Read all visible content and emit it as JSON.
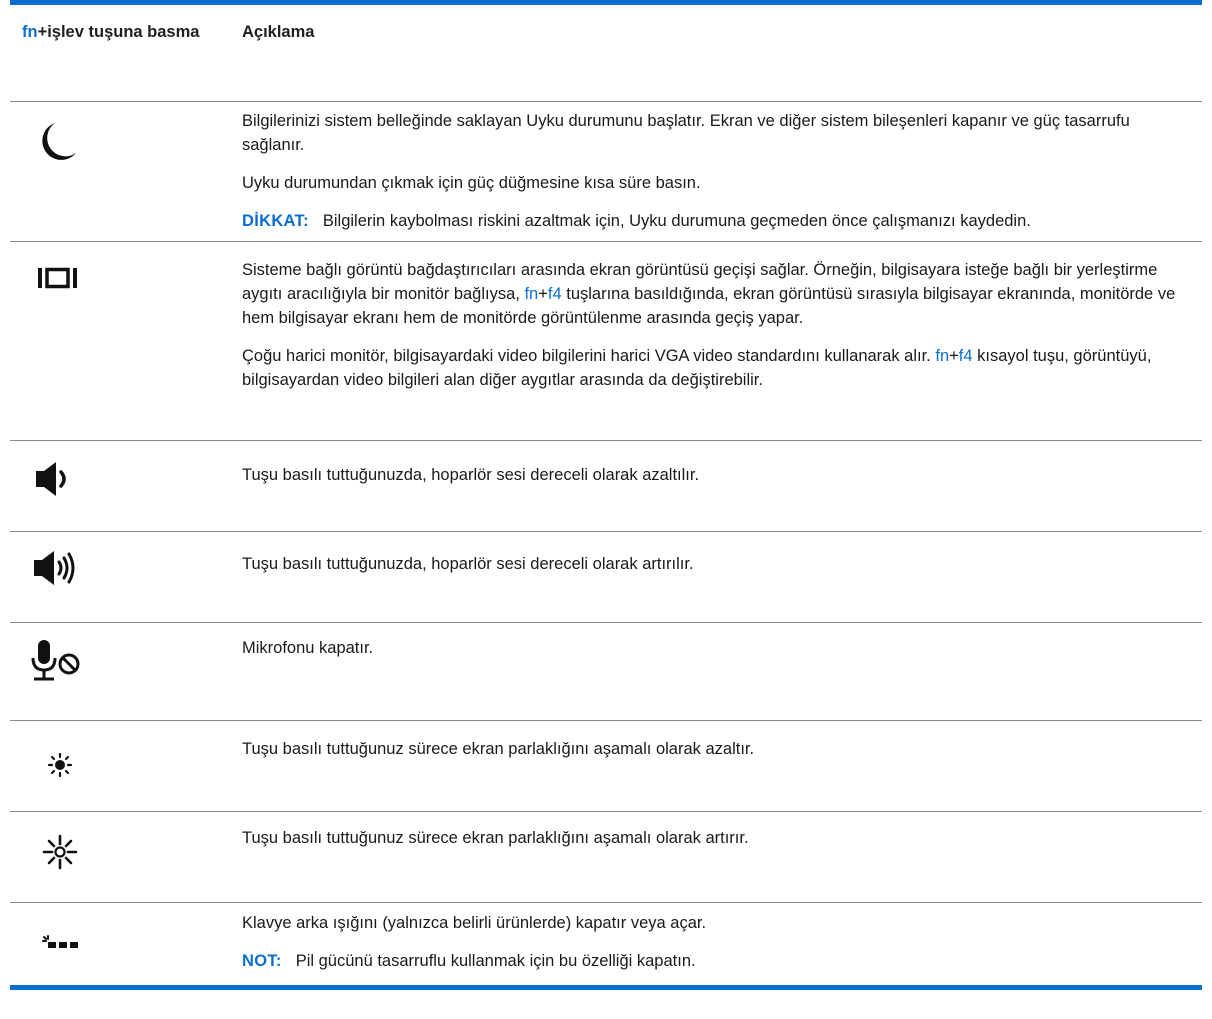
{
  "header": {
    "col1_fn": "fn",
    "col1_rest": "+işlev tuşuna basma",
    "col2": "Açıklama"
  },
  "rows": [
    {
      "icon": "moon-icon",
      "p1": "Bilgilerinizi sistem belleğinde saklayan Uyku durumunu başlatır. Ekran ve diğer sistem bileşenleri kapanır ve güç tasarrufu sağlanır.",
      "p2": "Uyku durumundan çıkmak için güç düğmesine kısa süre basın.",
      "note_label": "DİKKAT:",
      "note_text": "Bilgilerin kaybolması riskini azaltmak için, Uyku durumuna geçmeden önce çalışmanızı kaydedin."
    },
    {
      "icon": "display-switch-icon",
      "p1_a": "Sisteme bağlı görüntü bağdaştırıcıları arasında ekran görüntüsü geçişi sağlar. Örneğin, bilgisayara isteğe bağlı bir yerleştirme aygıtı aracılığıyla bir monitör bağlıysa,",
      "p1_fn": "fn",
      "p1_plus": "+",
      "p1_f4": "f4",
      "p1_b": "tuşlarına basıldığında, ekran görüntüsü sırasıyla bilgisayar ekranında, monitörde ve hem bilgisayar ekranı hem de monitörde görüntülenme arasında geçiş yapar.",
      "p2_a": "Çoğu harici monitör, bilgisayardaki video bilgilerini harici VGA video standardını kullanarak alır.",
      "p2_fn": "fn",
      "p2_plus": "+",
      "p2_f4": "f4",
      "p2_b": "kısayol tuşu, görüntüyü, bilgisayardan video bilgileri alan diğer aygıtlar arasında da değiştirebilir."
    },
    {
      "icon": "volume-down-icon",
      "p1": "Tuşu basılı tuttuğunuzda, hoparlör sesi dereceli olarak azaltılır."
    },
    {
      "icon": "volume-up-icon",
      "p1": "Tuşu basılı tuttuğunuzda, hoparlör sesi dereceli olarak artırılır."
    },
    {
      "icon": "mic-mute-icon",
      "p1": "Mikrofonu kapatır."
    },
    {
      "icon": "brightness-down-icon",
      "p1": "Tuşu basılı tuttuğunuz sürece ekran parlaklığını aşamalı olarak azaltır."
    },
    {
      "icon": "brightness-up-icon",
      "p1": "Tuşu basılı tuttuğunuz sürece ekran parlaklığını aşamalı olarak artırır."
    },
    {
      "icon": "keyboard-backlight-icon",
      "p1": "Klavye arka ışığını (yalnızca belirli ürünlerde) kapatır veya açar.",
      "note_label": "NOT:",
      "note_text": "Pil gücünü tasarruflu kullanmak için bu özelliği kapatın."
    }
  ]
}
